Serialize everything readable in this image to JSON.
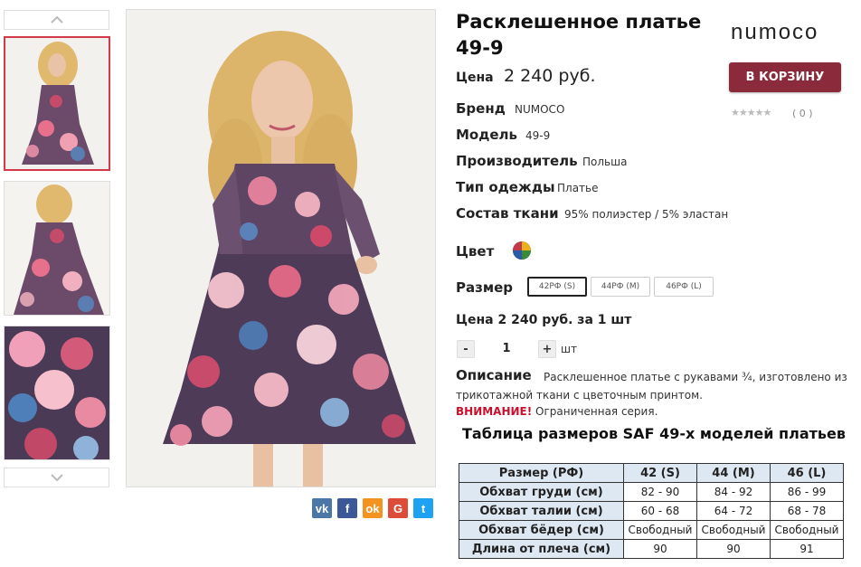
{
  "product": {
    "title": "Расклешенное платье 49-9",
    "brand_logo": "NUMOCO",
    "cart_button": "В КОРЗИНУ",
    "stars": "★★★★★",
    "rating_count": "( 0 )",
    "price_label": "Цена",
    "price_value": "2 240 руб.",
    "specs": [
      {
        "label": "Бренд",
        "value": "NUMOCO"
      },
      {
        "label": "Модель",
        "value": "49-9"
      },
      {
        "label": "Производитель",
        "value": "Польша"
      },
      {
        "label": "Тип одежды",
        "value": "Платье"
      },
      {
        "label": "Состав ткани",
        "value": "95% полиэстер / 5% эластан"
      }
    ],
    "color_label": "Цвет",
    "size_label": "Размер",
    "sizes": [
      "42РФ (S)",
      "44РФ (M)",
      "46РФ (L)"
    ],
    "selected_size": "42РФ (S)",
    "unit_price_text": "Цена 2 240 руб. за 1 шт",
    "qty_minus": "-",
    "qty_value": "1",
    "qty_plus": "+",
    "qty_unit": "шт",
    "description_label": "Описание",
    "description_line1": "Расклешенное платье с рукавами ¾, изготовлено из",
    "description_line2": "трикотажной ткани с цветочным принтом.",
    "warning_label": "ВНИМАНИЕ!",
    "warning_text": " Ограниченная серия."
  },
  "size_table": {
    "title": "Таблица размеров SAF 49-х моделей платьев",
    "header": [
      "Размер (РФ)",
      "42 (S)",
      "44 (M)",
      "46 (L)"
    ],
    "rows": [
      [
        "Обхват груди (см)",
        "82 - 90",
        "84 - 92",
        "86 - 99"
      ],
      [
        "Обхват талии (см)",
        "60 - 68",
        "64 - 72",
        "68 - 78"
      ],
      [
        "Обхват бёдер (см)",
        "Свободный",
        "Свободный",
        "Свободный"
      ],
      [
        "Длина от плеча (см)",
        "90",
        "90",
        "91"
      ]
    ]
  },
  "gallery": {
    "thumb_up_icon": "chevron-up-icon",
    "thumb_down_icon": "chevron-down-icon"
  },
  "social": [
    {
      "name": "vk-icon",
      "glyph": "vk",
      "color": "#4a76a8"
    },
    {
      "name": "facebook-icon",
      "glyph": "f",
      "color": "#3b5998"
    },
    {
      "name": "odnoklassniki-icon",
      "glyph": "ok",
      "color": "#f4931f"
    },
    {
      "name": "google-plus-icon",
      "glyph": "G",
      "color": "#dd4b39"
    },
    {
      "name": "twitter-icon",
      "glyph": "t",
      "color": "#1da1f2"
    }
  ],
  "colors": {
    "accent": "#8b2a3a",
    "thumb_active": "#d23a4a",
    "warning": "#c8102e",
    "table_head": "#dde8f3"
  }
}
